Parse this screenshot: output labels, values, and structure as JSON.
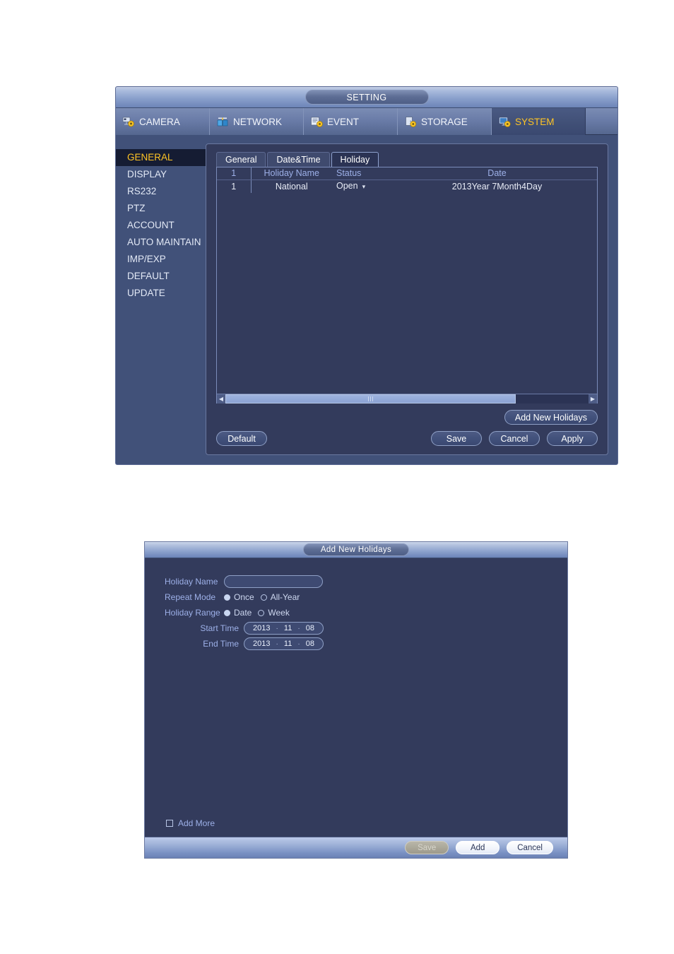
{
  "setting_window": {
    "title": "SETTING",
    "topnav": [
      {
        "label": "CAMERA",
        "icon": "camera-icon",
        "active": false
      },
      {
        "label": "NETWORK",
        "icon": "network-icon",
        "active": false
      },
      {
        "label": "EVENT",
        "icon": "event-icon",
        "active": false
      },
      {
        "label": "STORAGE",
        "icon": "storage-icon",
        "active": false
      },
      {
        "label": "SYSTEM",
        "icon": "system-icon",
        "active": true
      }
    ],
    "sidebar": {
      "items": [
        {
          "label": "GENERAL",
          "active": true
        },
        {
          "label": "DISPLAY",
          "active": false
        },
        {
          "label": "RS232",
          "active": false
        },
        {
          "label": "PTZ",
          "active": false
        },
        {
          "label": "ACCOUNT",
          "active": false
        },
        {
          "label": "AUTO MAINTAIN",
          "active": false
        },
        {
          "label": "IMP/EXP",
          "active": false
        },
        {
          "label": "DEFAULT",
          "active": false
        },
        {
          "label": "UPDATE",
          "active": false
        }
      ]
    },
    "subtabs": [
      {
        "label": "General",
        "active": false
      },
      {
        "label": "Date&Time",
        "active": false
      },
      {
        "label": "Holiday",
        "active": true
      }
    ],
    "table": {
      "headers": [
        "1",
        "Holiday Name",
        "Status",
        "Date"
      ],
      "rows": [
        {
          "index": "1",
          "name": "National",
          "status": "Open",
          "status_caret": "▾",
          "date": "2013Year 7Month4Day"
        }
      ]
    },
    "scrollbar": {
      "left_arrow": "◀",
      "right_arrow": "▶",
      "thumb_percent": 80
    },
    "buttons": {
      "add_new_holidays": "Add New Holidays",
      "default": "Default",
      "save": "Save",
      "cancel": "Cancel",
      "apply": "Apply"
    }
  },
  "dialog": {
    "title": "Add New Holidays",
    "fields": {
      "holiday_name_label": "Holiday Name",
      "holiday_name_value": "",
      "holiday_name_placeholder": "",
      "repeat_mode_label": "Repeat Mode",
      "repeat_mode_options": [
        {
          "label": "Once",
          "selected": true
        },
        {
          "label": "All-Year",
          "selected": false
        }
      ],
      "holiday_range_label": "Holiday Range",
      "holiday_range_options": [
        {
          "label": "Date",
          "selected": true
        },
        {
          "label": "Week",
          "selected": false
        }
      ],
      "start_time_label": "Start Time",
      "start_time": {
        "year": "2013",
        "month": "11",
        "day": "08",
        "sep": "·"
      },
      "end_time_label": "End Time",
      "end_time": {
        "year": "2013",
        "month": "11",
        "day": "08",
        "sep": "·"
      },
      "add_more_label": "Add More",
      "add_more_checked": false
    },
    "footer_buttons": {
      "save": "Save",
      "add": "Add",
      "cancel": "Cancel"
    }
  },
  "colors": {
    "window_bg": "#415179",
    "panel_bg": "#333b5c",
    "accent_yellow": "#ffc425",
    "header_blue": "#9db0e8",
    "sidebar_active_bg": "#151c33",
    "scroll_thumb": "#8ba3d4"
  }
}
